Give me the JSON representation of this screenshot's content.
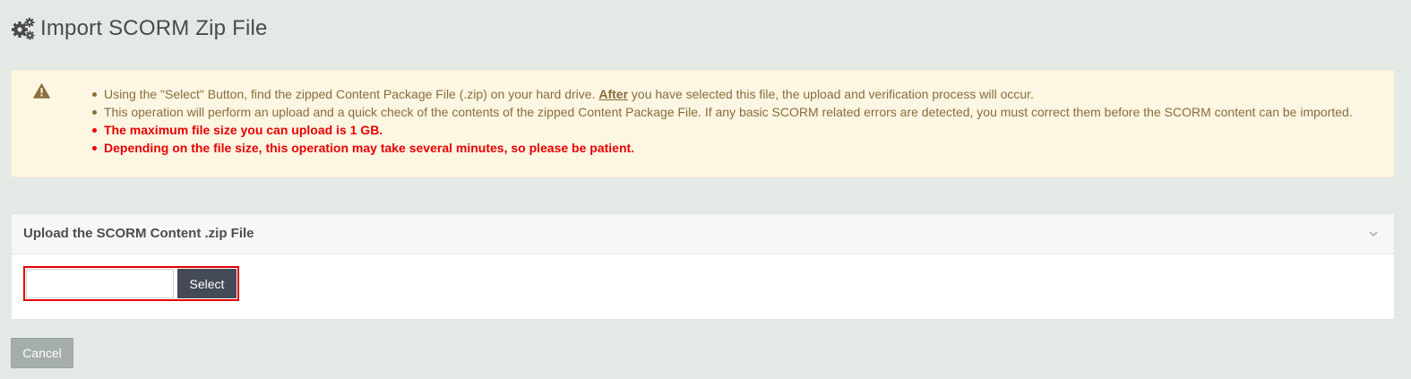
{
  "header": {
    "title": "Import SCORM Zip File",
    "icon": "gears-icon"
  },
  "alert": {
    "icon": "warning-triangle-icon",
    "items": [
      {
        "before": "Using the \"Select\" Button, find the zipped Content Package File (.zip) on your hard drive. ",
        "emphasis": "After",
        "after": " you have selected this file, the upload and verification process will occur."
      },
      {
        "text": "This operation will perform an upload and a quick check of the contents of the zipped Content Package File. If any basic SCORM related errors are detected, you must correct them before the SCORM content can be imported."
      },
      {
        "text": "The maximum file size you can upload is 1 GB."
      },
      {
        "text": "Depending on the file size, this operation may take several minutes, so please be patient."
      }
    ],
    "text_color": "#8a6d3b",
    "important_color": "#e80000",
    "background": "#fcf6e3"
  },
  "upload_panel": {
    "title": "Upload the SCORM Content .zip File",
    "toggle_icon": "chevron-down-icon",
    "file_input": {
      "value": "",
      "placeholder": ""
    },
    "select_label": "Select",
    "highlight_color": "#e10000"
  },
  "actions": {
    "cancel_label": "Cancel"
  }
}
